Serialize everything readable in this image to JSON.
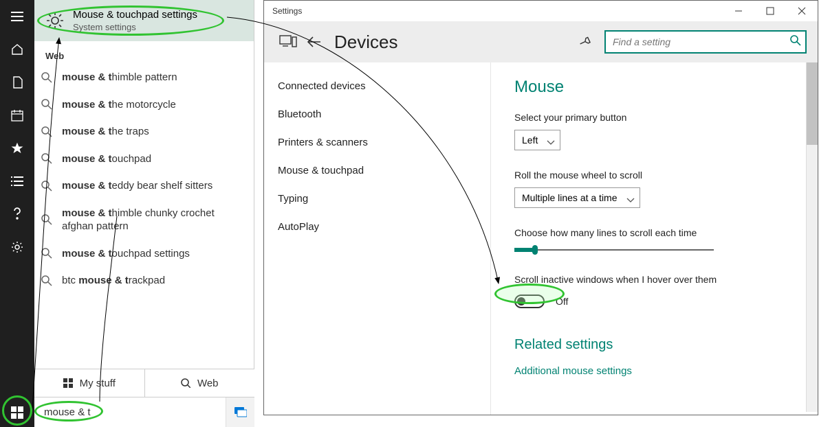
{
  "cortana": {
    "top": {
      "title": "Mouse & touchpad settings",
      "subtitle": "System settings"
    },
    "section_label": "Web",
    "suggestions": [
      {
        "q": "mouse & t",
        "rest": "himble pattern"
      },
      {
        "q": "mouse & t",
        "rest": "he motorcycle"
      },
      {
        "q": "mouse & t",
        "rest": "he traps"
      },
      {
        "q": "mouse & t",
        "rest": "ouchpad"
      },
      {
        "q": "mouse & t",
        "rest": "eddy bear shelf sitters"
      },
      {
        "q": "mouse & t",
        "rest": "himble chunky crochet afghan pattern"
      },
      {
        "q": "mouse & t",
        "rest": "ouchpad settings"
      },
      {
        "q_pre": "btc ",
        "q": "mouse & t",
        "rest": "rackpad"
      }
    ],
    "tabs": {
      "my_stuff": "My stuff",
      "web": "Web"
    },
    "search_value": "mouse & t"
  },
  "settings": {
    "title": "Settings",
    "header_title": "Devices",
    "search_placeholder": "Find a setting",
    "nav": [
      "Connected devices",
      "Bluetooth",
      "Printers & scanners",
      "Mouse & touchpad",
      "Typing",
      "AutoPlay"
    ],
    "content": {
      "heading": "Mouse",
      "primary_label": "Select your primary button",
      "primary_value": "Left",
      "roll_label": "Roll the mouse wheel to scroll",
      "roll_value": "Multiple lines at a time",
      "lines_label": "Choose how many lines to scroll each time",
      "scroll_inactive_label": "Scroll inactive windows when I hover over them",
      "toggle_value": "Off",
      "related_heading": "Related settings",
      "related_link": "Additional mouse settings"
    }
  },
  "annotation_colors": {
    "ellipse": "#31c331"
  }
}
